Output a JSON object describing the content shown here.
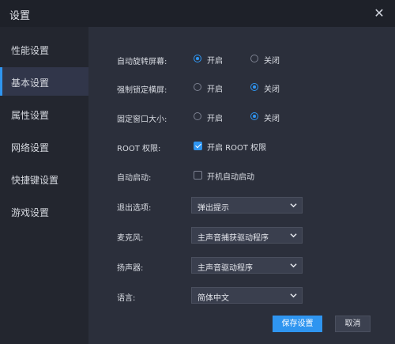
{
  "window": {
    "title": "设置"
  },
  "sidebar": {
    "items": [
      {
        "label": "性能设置"
      },
      {
        "label": "基本设置"
      },
      {
        "label": "属性设置"
      },
      {
        "label": "网络设置"
      },
      {
        "label": "快捷键设置"
      },
      {
        "label": "游戏设置"
      }
    ],
    "active_index": 1
  },
  "settings": {
    "auto_rotate": {
      "label": "自动旋转屏幕:",
      "on": "开启",
      "off": "关闭",
      "selected": "开启"
    },
    "force_landscape": {
      "label": "强制锁定横屏:",
      "on": "开启",
      "off": "关闭",
      "selected": "关闭"
    },
    "fixed_window": {
      "label": "固定窗口大小:",
      "on": "开启",
      "off": "关闭",
      "selected": "关闭"
    },
    "root": {
      "label": "ROOT 权限:",
      "option": "开启 ROOT 权限",
      "checked": true
    },
    "autostart": {
      "label": "自动启动:",
      "option": "开机自动启动",
      "checked": false
    },
    "exit": {
      "label": "退出选项:",
      "value": "弹出提示"
    },
    "microphone": {
      "label": "麦克风:",
      "value": "主声音捕获驱动程序"
    },
    "speaker": {
      "label": "扬声器:",
      "value": "主声音驱动程序"
    },
    "language": {
      "label": "语言:",
      "value": "简体中文"
    }
  },
  "buttons": {
    "save": "保存设置",
    "cancel": "取消"
  },
  "colors": {
    "accent": "#2f95f0",
    "sidebar_bg": "#23262f",
    "content_bg": "#2b2f3b",
    "titlebar_bg": "#1e2129"
  },
  "icons": {
    "close": "close-icon",
    "dropdown": "chevron-down-icon"
  }
}
